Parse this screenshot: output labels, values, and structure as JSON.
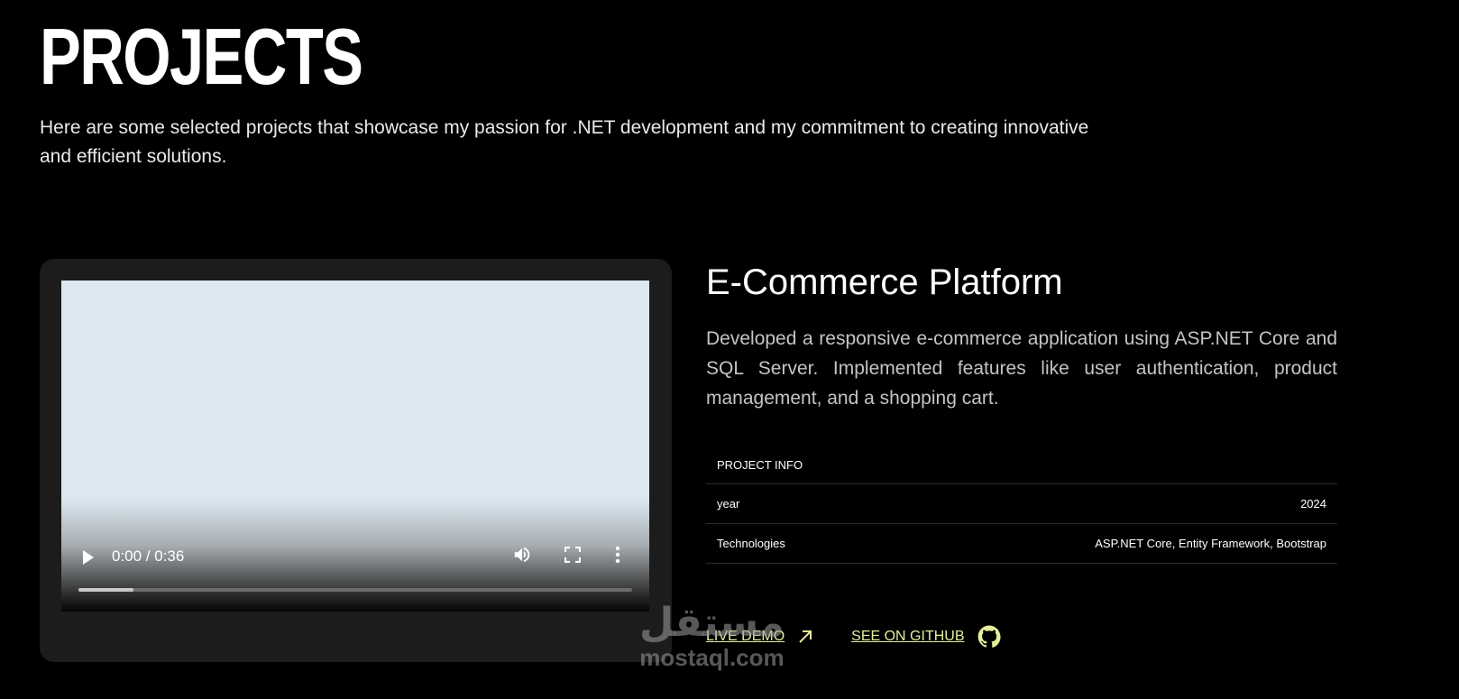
{
  "header": {
    "title": "PROJECTS",
    "intro": "Here are some selected projects that showcase my passion for .NET development and my commitment to creating innovative and efficient solutions."
  },
  "video_player": {
    "time": "0:00 / 0:36",
    "progress_buffered_fraction": 0.1,
    "icons": [
      "play-icon",
      "volume-icon",
      "fullscreen-icon",
      "more-options-icon"
    ]
  },
  "project": {
    "title": "E-Commerce Platform",
    "description": "Developed a responsive e-commerce application using ASP.NET Core and SQL Server. Implemented features like user authentication, product management, and a shopping cart.",
    "info_heading": "PROJECT INFO",
    "info_rows": [
      {
        "label": "year",
        "value": "2024"
      },
      {
        "label": "Technologies",
        "value": "ASP.NET Core, Entity Framework, Bootstrap"
      }
    ],
    "live_demo_label": "LIVE DEMO",
    "github_label": "SEE ON GITHUB"
  },
  "watermark": {
    "logo_text": "مستقل",
    "site": "mostaql.com"
  },
  "colors": {
    "background": "#000000",
    "card": "#1c1c1c",
    "accent_link": "#e6ee9c"
  }
}
